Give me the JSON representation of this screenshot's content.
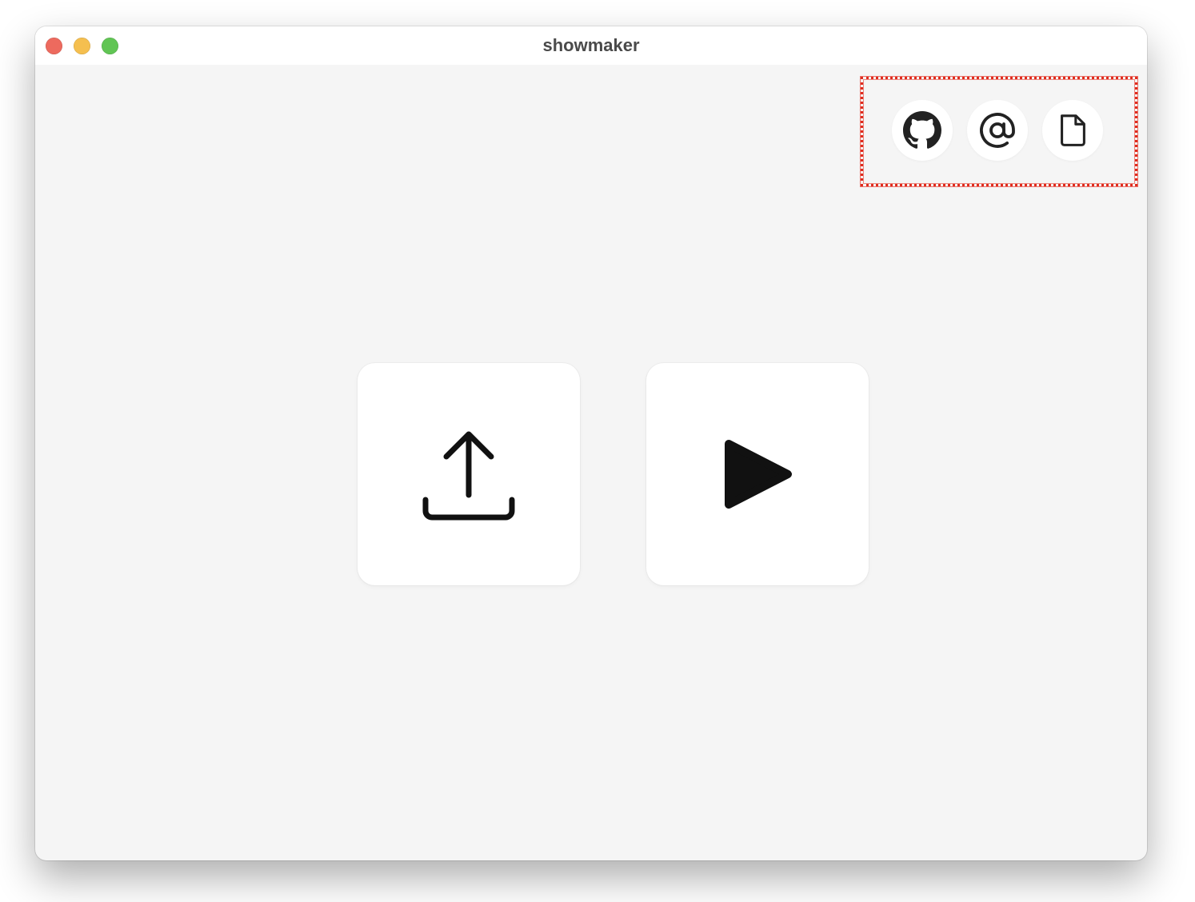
{
  "window": {
    "title": "showmaker",
    "controls": {
      "close_color": "#ed6a5e",
      "minimize_color": "#f5bf4f",
      "maximize_color": "#61c554"
    }
  },
  "header_actions": {
    "highlight_color": "#e02a1c",
    "items": [
      {
        "id": "github",
        "icon": "github-icon"
      },
      {
        "id": "email",
        "icon": "at-sign-icon"
      },
      {
        "id": "docs",
        "icon": "document-icon"
      }
    ]
  },
  "main_actions": [
    {
      "id": "upload",
      "icon": "upload-icon"
    },
    {
      "id": "play",
      "icon": "play-icon"
    }
  ],
  "colors": {
    "background": "#f5f5f5",
    "card": "#ffffff",
    "icon": "#111111"
  }
}
